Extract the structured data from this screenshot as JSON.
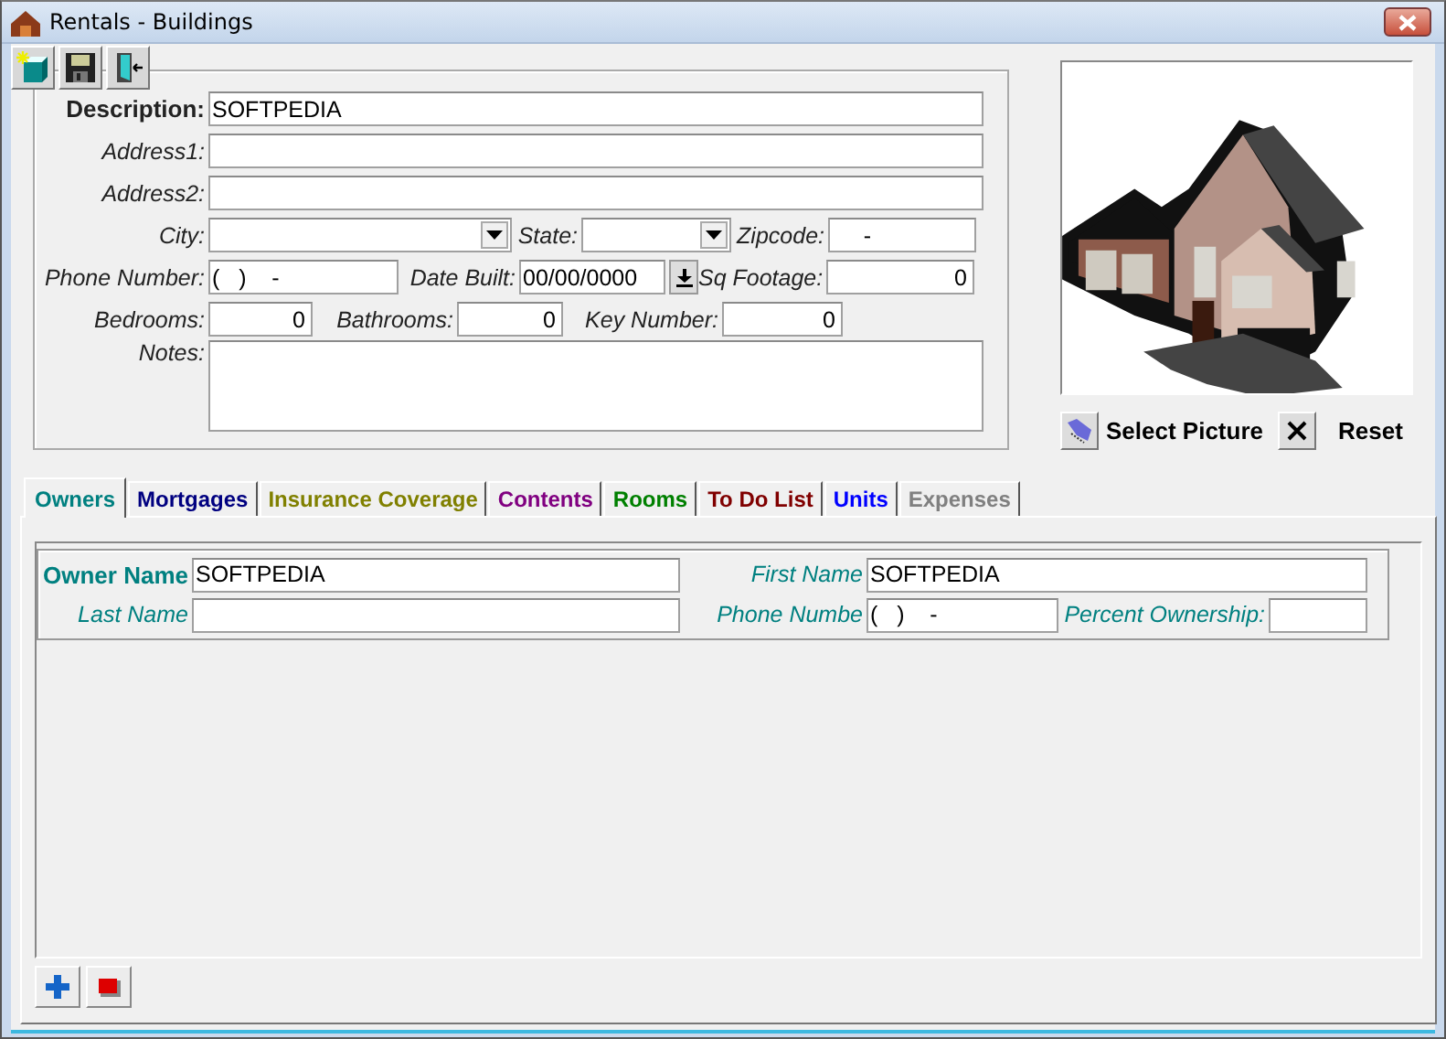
{
  "window": {
    "title": "Rentals - Buildings"
  },
  "toolbar": [
    {
      "kind": "new"
    },
    {
      "kind": "save"
    },
    {
      "kind": "exit"
    }
  ],
  "form": {
    "rows": [
      [
        {
          "label": "Description:",
          "value": "SOFTPEDIA",
          "kind": "text",
          "bold": true
        }
      ],
      [
        {
          "label": "Address1:",
          "kind": "text",
          "bold": false
        }
      ],
      [
        {
          "label": "Address2:",
          "kind": "text",
          "bold": false
        }
      ],
      [
        {
          "label": "City:",
          "kind": "dropdown",
          "bold": false
        },
        {
          "label": "State:",
          "kind": "dropdown",
          "bold": false
        },
        {
          "label": "Zipcode:",
          "value": "     -",
          "kind": "text",
          "bold": false
        }
      ],
      [
        {
          "label": "Phone Number:",
          "value": "(   )    -",
          "kind": "text",
          "bold": false
        },
        {
          "label": "Date Built:",
          "value": "00/00/0000",
          "kind": "date",
          "bold": false
        },
        {
          "label": "Sq Footage:",
          "value": "0",
          "kind": "number",
          "bold": false
        }
      ],
      [
        {
          "label": "Bedrooms:",
          "value": "0",
          "kind": "number",
          "bold": false
        },
        {
          "label": "Bathrooms:",
          "value": "0",
          "kind": "number",
          "bold": false
        },
        {
          "label": "Key Number:",
          "value": "0",
          "kind": "number",
          "bold": false
        }
      ],
      [
        {
          "label": "Notes:",
          "kind": "memo",
          "bold": false
        }
      ]
    ]
  },
  "picture_buttons": [
    {
      "label": "Select Picture",
      "kind": "select"
    },
    {
      "label": "Reset",
      "kind": "reset"
    }
  ],
  "tabs": [
    {
      "label": "Owners",
      "color": "#008080",
      "selected": true
    },
    {
      "label": "Mortgages",
      "color": "#000080",
      "selected": false
    },
    {
      "label": "Insurance Coverage",
      "color": "#808000",
      "selected": false
    },
    {
      "label": "Contents",
      "color": "#800080",
      "selected": false
    },
    {
      "label": "Rooms",
      "color": "#008000",
      "selected": false
    },
    {
      "label": "To Do List",
      "color": "#800000",
      "selected": false
    },
    {
      "label": "Units",
      "color": "#0000ff",
      "selected": false
    },
    {
      "label": "Expenses",
      "color": "#808080",
      "selected": false
    }
  ],
  "owner": {
    "rows": [
      [
        {
          "label": "Owner Name",
          "value": "SOFTPEDIA",
          "bold": true
        },
        {
          "label": "First Name",
          "value": "SOFTPEDIA",
          "bold": false
        }
      ],
      [
        {
          "label": "Last Name",
          "bold": false
        },
        {
          "label": "Phone Numbe",
          "value": "(   )    -",
          "bold": false
        },
        {
          "label": "Percent Ownership:",
          "bold": false
        }
      ]
    ]
  },
  "record_buttons": [
    {
      "kind": "add"
    },
    {
      "kind": "delete"
    }
  ]
}
